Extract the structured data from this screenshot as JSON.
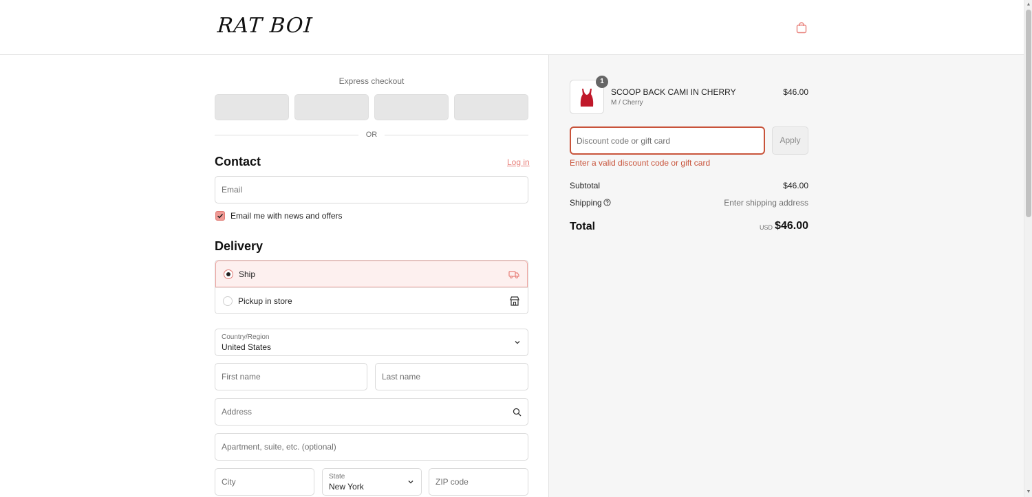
{
  "header": {
    "logo": "RAT BOI",
    "cart_icon": "shopping-bag-icon"
  },
  "express": {
    "label": "Express checkout",
    "buttons": [
      "",
      "",
      "",
      ""
    ]
  },
  "divider": {
    "or_label": "OR"
  },
  "contact": {
    "title": "Contact",
    "login_label": "Log in",
    "email_placeholder": "Email",
    "news_checkbox_label": "Email me with news and offers",
    "news_checked": true
  },
  "delivery": {
    "title": "Delivery",
    "options": [
      {
        "label": "Ship",
        "selected": true,
        "icon": "truck-icon"
      },
      {
        "label": "Pickup in store",
        "selected": false,
        "icon": "store-icon"
      }
    ],
    "country_label": "Country/Region",
    "country_value": "United States",
    "first_name_placeholder": "First name",
    "last_name_placeholder": "Last name",
    "address_placeholder": "Address",
    "apartment_placeholder": "Apartment, suite, etc. (optional)",
    "city_placeholder": "City",
    "state_label": "State",
    "state_value": "New York",
    "zip_placeholder": "ZIP code"
  },
  "summary": {
    "product": {
      "name": "SCOOP BACK CAMI IN CHERRY",
      "variant": "M / Cherry",
      "price": "$46.00",
      "quantity": "1"
    },
    "discount_placeholder": "Discount code or gift card",
    "apply_label": "Apply",
    "discount_error": "Enter a valid discount code or gift card",
    "subtotal_label": "Subtotal",
    "subtotal_value": "$46.00",
    "shipping_label": "Shipping",
    "shipping_value": "Enter shipping address",
    "total_label": "Total",
    "currency": "USD",
    "total_value": "$46.00"
  },
  "colors": {
    "accent": "#e8807a",
    "error": "#c8533a",
    "selected_bg": "#fdf0ef"
  }
}
